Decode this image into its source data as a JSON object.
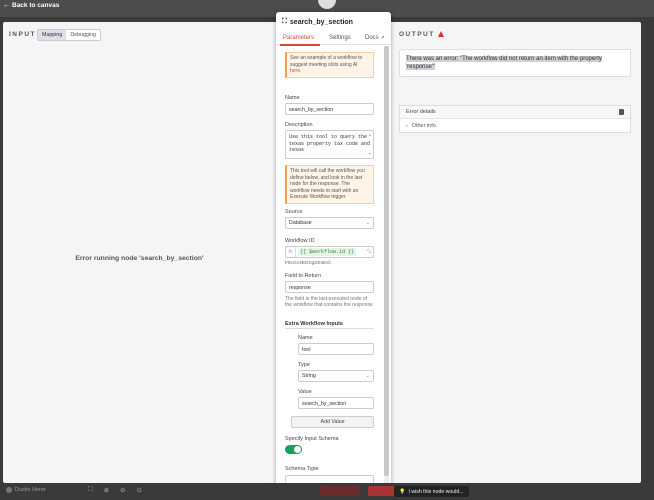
{
  "topbar": {
    "back_label": "Back to canvas"
  },
  "input_panel": {
    "title": "INPUT",
    "mode_tabs": [
      "Mapping",
      "Debugging"
    ],
    "error_text": "Error running node 'search_by_section'"
  },
  "output_panel": {
    "title": "OUTPUT",
    "error_message": "There was an error: \"The workflow did not return an item with the property 'response'\"",
    "error_details_label": "Error details",
    "other_info_label": "Other info"
  },
  "node": {
    "name": "search_by_section",
    "tabs": {
      "parameters": "Parameters",
      "settings": "Settings",
      "docs": "Docs"
    },
    "example_notice_text": "See an example of a workflow to suggest meeting slots using AI ",
    "example_notice_link": "here",
    "name_label": "Name",
    "name_value": "search_by_section",
    "description_label": "Description",
    "description_value": "Use this tool to query the texas property tax code and texas",
    "tool_notice": "This tool will call the workflow you define below, and look in the last node for the response. The workflow needs to start with an Execute Workflow trigger",
    "source_label": "Source",
    "source_value": "Database",
    "workflow_id_label": "Workflow ID",
    "workflow_id_expr": "{{ $workflow.id }}",
    "workflow_id_resolved": "F9cGv4EDXgD04EKl",
    "field_label": "Field to Return",
    "field_value": "response",
    "field_hint": "The field in the last-executed node of the workflow that contains the response",
    "extra_inputs_label": "Extra Workflow Inputs",
    "sub_name_label": "Name",
    "sub_name_value": "tool",
    "sub_type_label": "Type",
    "sub_type_value": "String",
    "sub_value_label": "Value",
    "sub_value_value": "search_by_section",
    "add_value_label": "Add Value",
    "schema_label": "Specify Input Schema",
    "schema_type_label": "Schema Type",
    "schema_enabled": true
  },
  "bottombar": {
    "user": "Dustin Herer",
    "wish_label": "I wish this node would..."
  },
  "colors": {
    "accent": "#e0452f",
    "toggle_on": "#13a35a",
    "warning_bg": "#fef5e7"
  }
}
